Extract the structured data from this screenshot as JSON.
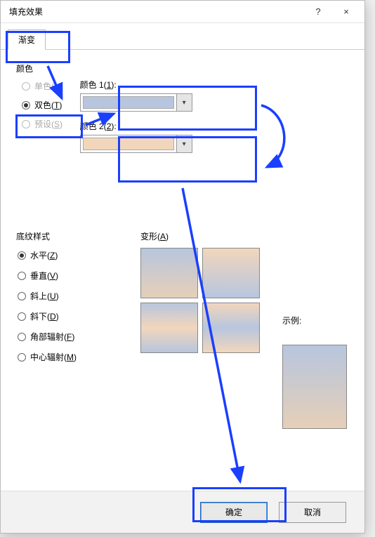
{
  "title": "填充效果",
  "tab": {
    "gradient": "渐变"
  },
  "colors": {
    "group_label": "颜色",
    "radios": {
      "single": "单色(N)",
      "double": "双色(T)",
      "preset": "预设(S)"
    },
    "color1_label": "颜色 1(1):",
    "color2_label": "颜色 2(2):",
    "swatch1": "#b7c6de",
    "swatch2": "#f2d6bc"
  },
  "shading": {
    "label": "底纹样式",
    "options": {
      "horizontal": "水平(Z)",
      "vertical": "垂直(V)",
      "diag_up": "斜上(U)",
      "diag_down": "斜下(D)",
      "corner": "角部辐射(F)",
      "center": "中心辐射(M)"
    }
  },
  "variant_label": "变形(A)",
  "example_label": "示例:",
  "ok": "确定",
  "cancel": "取消",
  "help_tip": "?",
  "close_tip": "×"
}
